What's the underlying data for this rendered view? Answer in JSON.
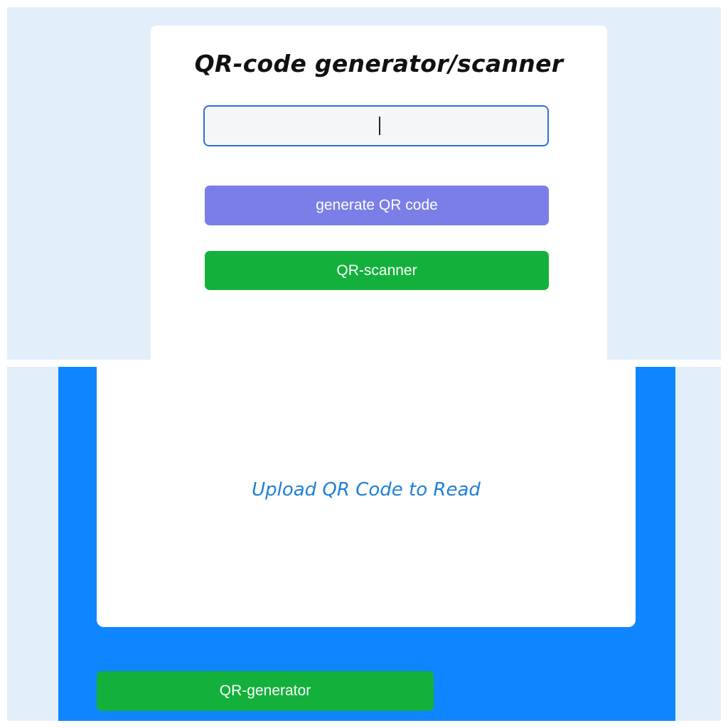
{
  "generator": {
    "title": "QR-code generator/scanner",
    "input_value": "",
    "generate_label": "generate QR code",
    "scanner_label": "QR-scanner"
  },
  "scanner": {
    "upload_label": "Upload QR Code to Read",
    "generator_label": "QR-generator"
  },
  "colors": {
    "page_background": "#e3eefb",
    "card": "#ffffff",
    "input_border": "#2f6fd8",
    "generate_button": "#7b7ee6",
    "green_button": "#13b13c",
    "scanner_background": "#0f86ff",
    "upload_text": "#1e7fd6"
  }
}
